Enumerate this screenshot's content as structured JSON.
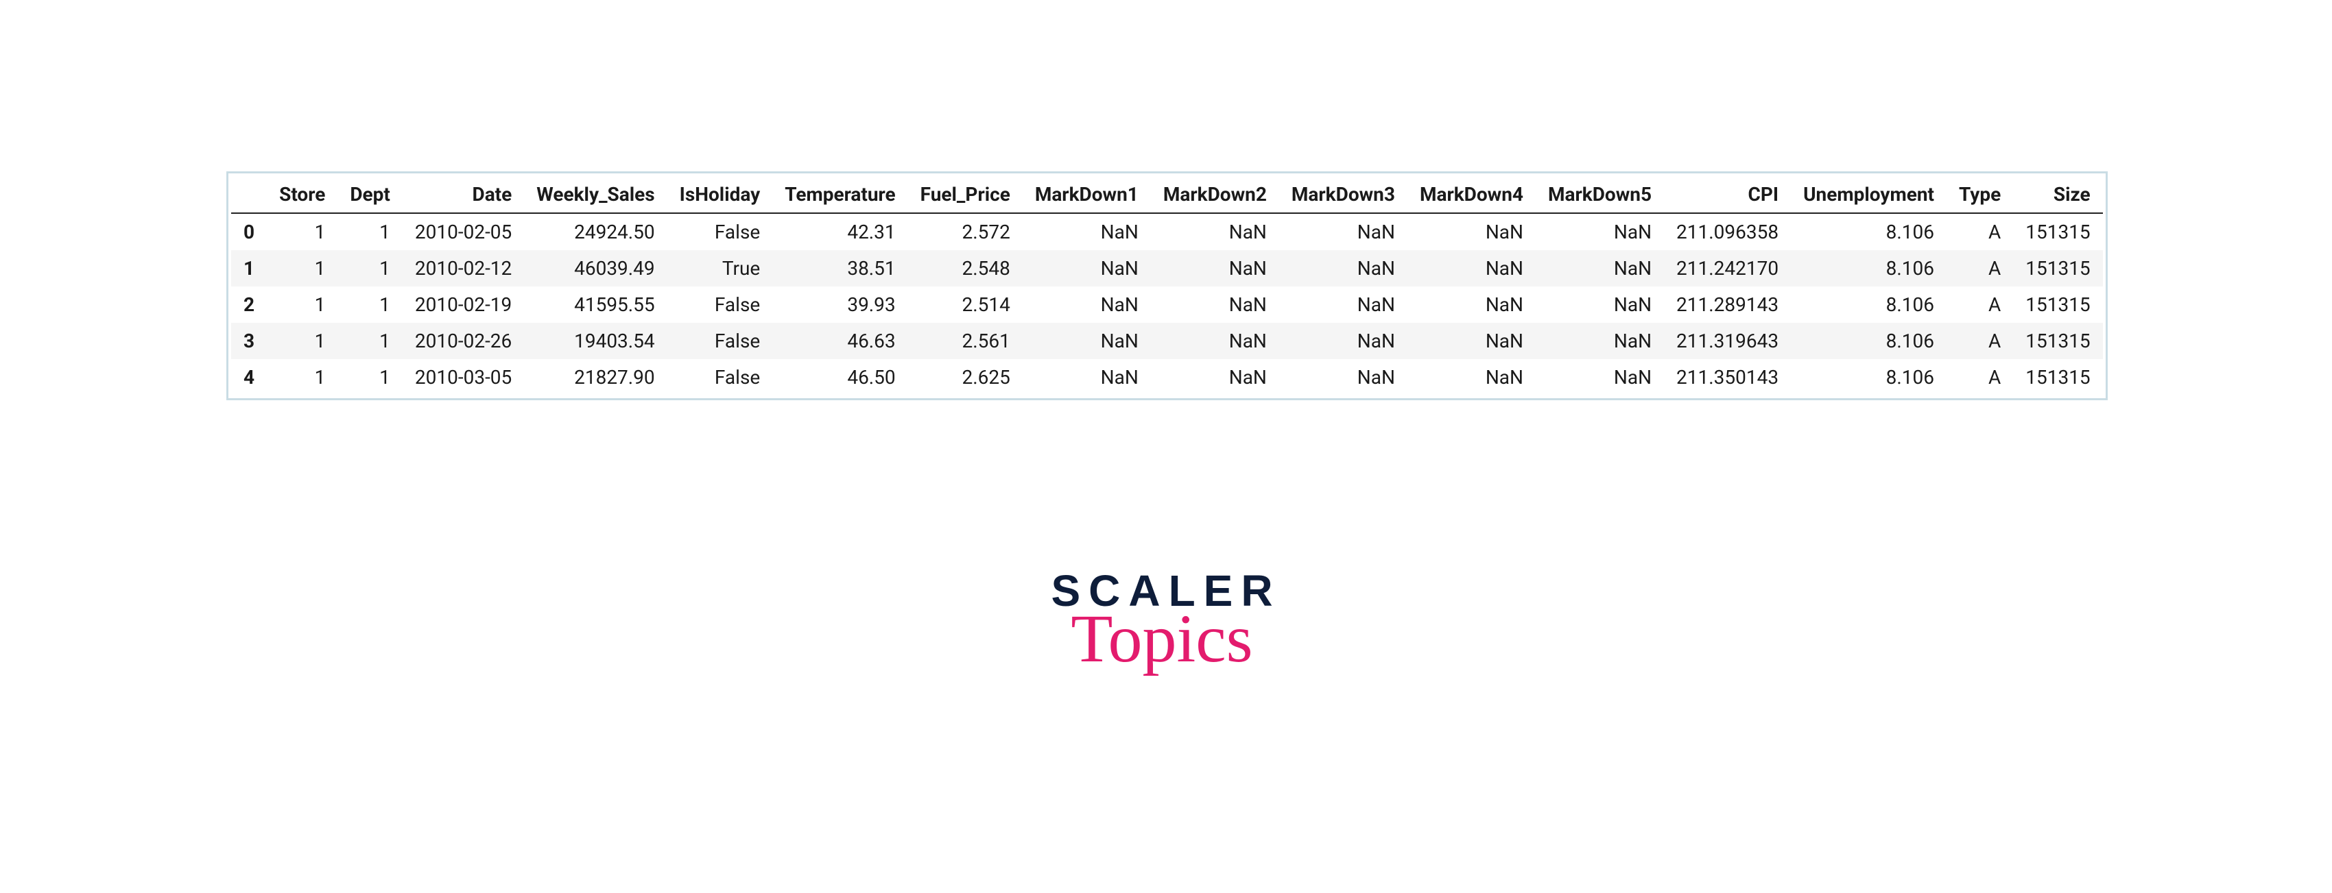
{
  "chart_data": {
    "type": "table",
    "columns": [
      "Store",
      "Dept",
      "Date",
      "Weekly_Sales",
      "IsHoliday",
      "Temperature",
      "Fuel_Price",
      "MarkDown1",
      "MarkDown2",
      "MarkDown3",
      "MarkDown4",
      "MarkDown5",
      "CPI",
      "Unemployment",
      "Type",
      "Size"
    ],
    "index": [
      "0",
      "1",
      "2",
      "3",
      "4"
    ],
    "rows": [
      [
        "1",
        "1",
        "2010-02-05",
        "24924.50",
        "False",
        "42.31",
        "2.572",
        "NaN",
        "NaN",
        "NaN",
        "NaN",
        "NaN",
        "211.096358",
        "8.106",
        "A",
        "151315"
      ],
      [
        "1",
        "1",
        "2010-02-12",
        "46039.49",
        "True",
        "38.51",
        "2.548",
        "NaN",
        "NaN",
        "NaN",
        "NaN",
        "NaN",
        "211.242170",
        "8.106",
        "A",
        "151315"
      ],
      [
        "1",
        "1",
        "2010-02-19",
        "41595.55",
        "False",
        "39.93",
        "2.514",
        "NaN",
        "NaN",
        "NaN",
        "NaN",
        "NaN",
        "211.289143",
        "8.106",
        "A",
        "151315"
      ],
      [
        "1",
        "1",
        "2010-02-26",
        "19403.54",
        "False",
        "46.63",
        "2.561",
        "NaN",
        "NaN",
        "NaN",
        "NaN",
        "NaN",
        "211.319643",
        "8.106",
        "A",
        "151315"
      ],
      [
        "1",
        "1",
        "2010-03-05",
        "21827.90",
        "False",
        "46.50",
        "2.625",
        "NaN",
        "NaN",
        "NaN",
        "NaN",
        "NaN",
        "211.350143",
        "8.106",
        "A",
        "151315"
      ]
    ]
  },
  "brand": {
    "name_upper": "SCALER",
    "name_lower": "Topics"
  }
}
